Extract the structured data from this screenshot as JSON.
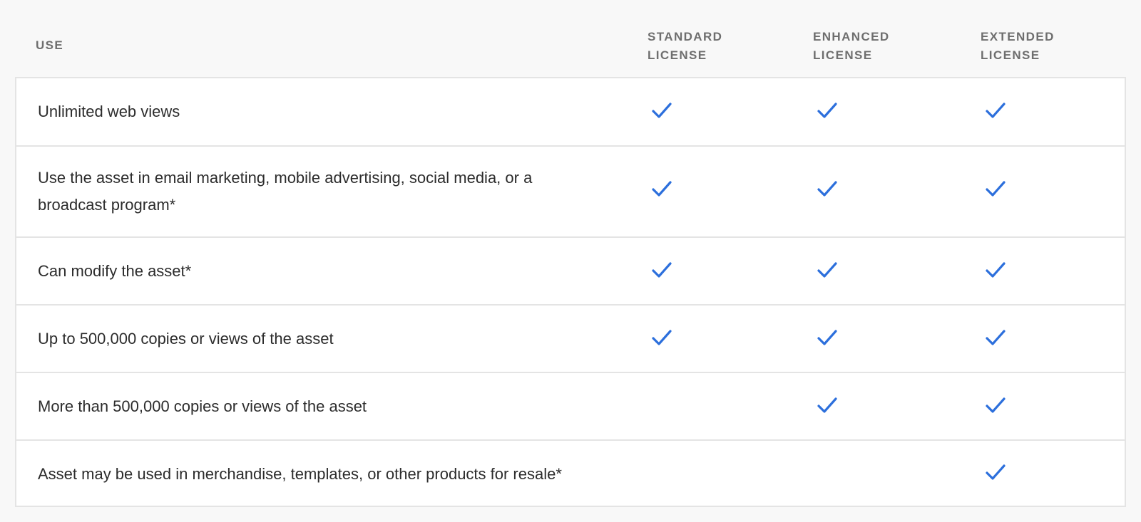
{
  "header": {
    "use": "USE",
    "standard": "STANDARD LICENSE",
    "enhanced": "ENHANCED LICENSE",
    "extended": "EXTENDED LICENSE"
  },
  "accent_color": "#2c6fdc",
  "check_icon": "checkmark-icon",
  "rows": [
    {
      "label": "Unlimited web views",
      "standard": true,
      "enhanced": true,
      "extended": true
    },
    {
      "label": "Use the asset in email marketing, mobile advertising, social media, or a broadcast program*",
      "standard": true,
      "enhanced": true,
      "extended": true
    },
    {
      "label": "Can modify the asset*",
      "standard": true,
      "enhanced": true,
      "extended": true
    },
    {
      "label": "Up to 500,000 copies or views of the asset",
      "standard": true,
      "enhanced": true,
      "extended": true
    },
    {
      "label": "More than 500,000 copies or views of the asset",
      "standard": false,
      "enhanced": true,
      "extended": true
    },
    {
      "label": "Asset may be used in merchandise, templates, or other products for resale*",
      "standard": false,
      "enhanced": false,
      "extended": true
    }
  ]
}
